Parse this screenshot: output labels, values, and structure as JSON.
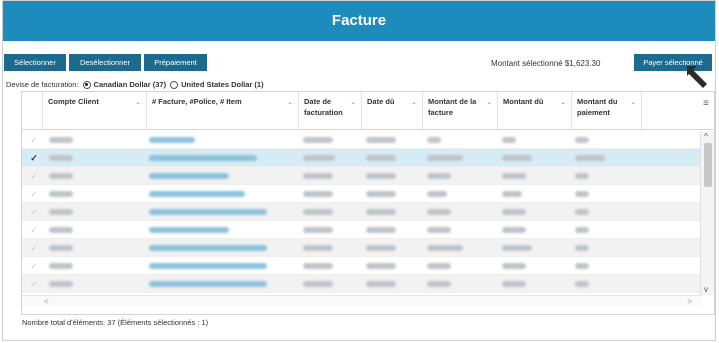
{
  "header": {
    "title": "Facture"
  },
  "toolbar": {
    "select_label": "Sélectionner",
    "deselect_label": "Desélectionner",
    "prepay_label": "Prépaiement",
    "amount_label": "Montant sélectionné $1,623.30",
    "pay_label": "Payer sélectionné"
  },
  "currency": {
    "label": "Devise de facturation:",
    "options": [
      {
        "label": "Canadian Dollar (37)",
        "selected": true
      },
      {
        "label": "United States Dollar (1)",
        "selected": false
      }
    ]
  },
  "grid": {
    "columns": [
      "Compte Client",
      "# Facture, #Police, # Item",
      "Date de facturation",
      "Date dû",
      "Montant de la facture",
      "Montant dû",
      "Montant du paiement"
    ],
    "rows_checked": [
      false,
      true,
      false,
      false,
      false,
      false,
      false,
      false,
      false
    ]
  },
  "footer": {
    "text": "Nombre total d'éléments: 37 (Éléments sélectionnés : 1)"
  },
  "colors": {
    "header": "#1e8bbd",
    "button": "#1d6a8f",
    "selected_row": "#d6ecf4"
  }
}
